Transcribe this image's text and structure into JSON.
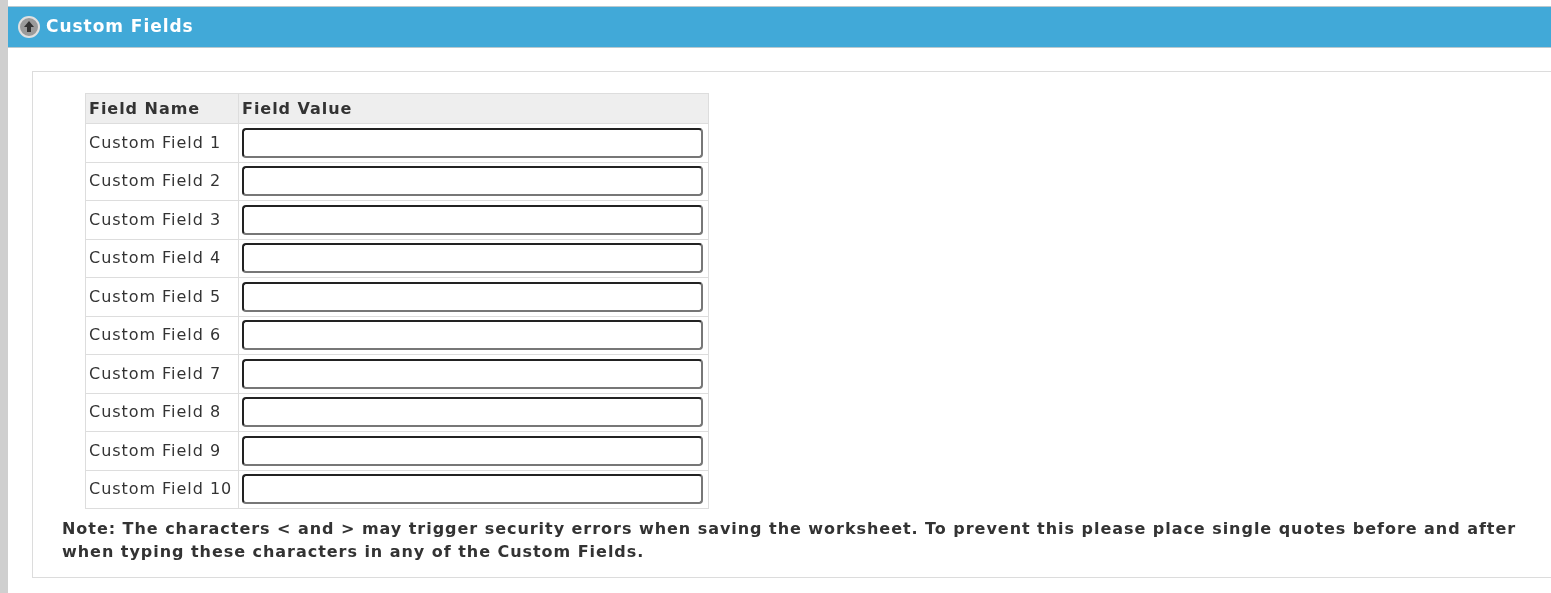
{
  "header": {
    "title": "Custom Fields",
    "expanded": true
  },
  "table": {
    "columns": [
      "Field Name",
      "Field Value"
    ],
    "rows": [
      {
        "name": "Custom Field 1"
      },
      {
        "name": "Custom Field 2"
      },
      {
        "name": "Custom Field 3"
      },
      {
        "name": "Custom Field 4"
      },
      {
        "name": "Custom Field 5"
      },
      {
        "name": "Custom Field 6"
      },
      {
        "name": "Custom Field 7"
      },
      {
        "name": "Custom Field 8"
      },
      {
        "name": "Custom Field 9"
      },
      {
        "name": "Custom Field 10"
      }
    ]
  },
  "note": "Note: The characters < and > may trigger security errors when saving the worksheet. To prevent this please place single quotes before and after when typing these characters in any of the Custom Fields."
}
